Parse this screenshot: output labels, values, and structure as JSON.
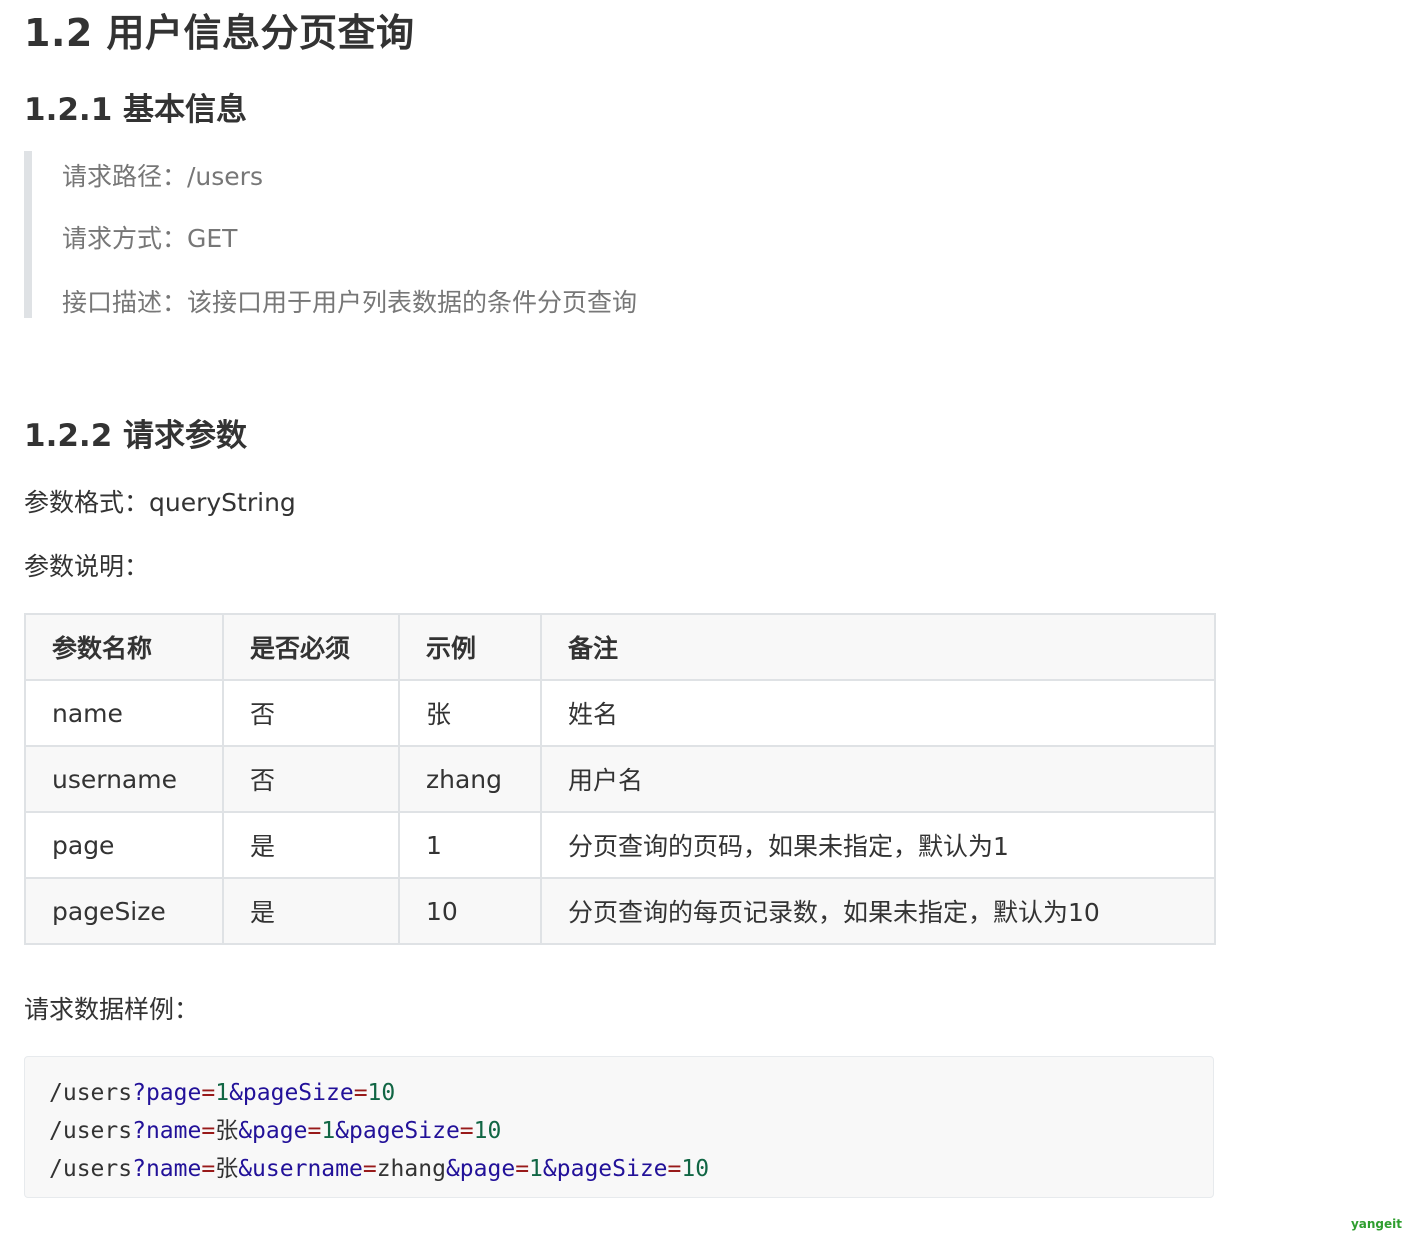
{
  "title": "1.2 用户信息分页查询",
  "section_basic": {
    "heading": "1.2.1 基本信息",
    "path": "请求路径：/users",
    "method": "请求方式：GET",
    "description": "接口描述：该接口用于用户列表数据的条件分页查询"
  },
  "section_params": {
    "heading": "1.2.2 请求参数",
    "format": "参数格式：queryString",
    "explain_label": "参数说明：",
    "table": {
      "headers": [
        "参数名称",
        "是否必须",
        "示例",
        "备注"
      ],
      "rows": [
        [
          "name",
          "否",
          "张",
          "姓名"
        ],
        [
          "username",
          "否",
          "zhang",
          "用户名"
        ],
        [
          "page",
          "是",
          "1",
          "分页查询的页码，如果未指定，默认为1"
        ],
        [
          "pageSize",
          "是",
          "10",
          "分页查询的每页记录数，如果未指定，默认为10"
        ]
      ]
    },
    "sample_label": "请求数据样例：",
    "code_lines": [
      [
        [
          "plain",
          "/users"
        ],
        [
          "kw",
          "?page"
        ],
        [
          "op",
          "="
        ],
        [
          "num",
          "1"
        ],
        [
          "kw",
          "&pageSize"
        ],
        [
          "op",
          "="
        ],
        [
          "num",
          "10"
        ]
      ],
      [
        [
          "plain",
          "/users"
        ],
        [
          "kw",
          "?name"
        ],
        [
          "op",
          "="
        ],
        [
          "plain",
          "张"
        ],
        [
          "kw",
          "&page"
        ],
        [
          "op",
          "="
        ],
        [
          "num",
          "1"
        ],
        [
          "kw",
          "&pageSize"
        ],
        [
          "op",
          "="
        ],
        [
          "num",
          "10"
        ]
      ],
      [
        [
          "plain",
          "/users"
        ],
        [
          "kw",
          "?name"
        ],
        [
          "op",
          "="
        ],
        [
          "plain",
          "张"
        ],
        [
          "kw",
          "&username"
        ],
        [
          "op",
          "="
        ],
        [
          "plain",
          "zhang"
        ],
        [
          "kw",
          "&page"
        ],
        [
          "op",
          "="
        ],
        [
          "num",
          "1"
        ],
        [
          "kw",
          "&pageSize"
        ],
        [
          "op",
          "="
        ],
        [
          "num",
          "10"
        ]
      ]
    ]
  },
  "watermark": "yangeit"
}
